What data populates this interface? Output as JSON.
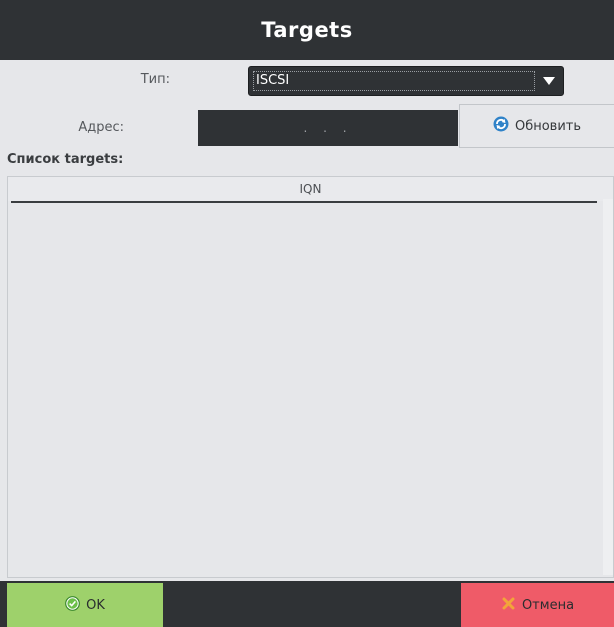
{
  "window": {
    "title": "Targets"
  },
  "form": {
    "type_label": "Тип:",
    "type_value": "ISCSI",
    "address_label": "Адрес:",
    "address_value": ". . .",
    "refresh_label": "Обновить"
  },
  "targets": {
    "title": "Список targets:",
    "columns": [
      "IQN"
    ],
    "rows": []
  },
  "footer": {
    "ok_label": "OK",
    "cancel_label": "Отмена"
  },
  "icons": {
    "dropdown": "chevron-down-icon",
    "refresh": "refresh-icon",
    "ok": "check-circle-icon",
    "cancel": "close-icon"
  },
  "colors": {
    "dark": "#2f3235",
    "ok": "#9ed16b",
    "cancel": "#ef5b68",
    "panel": "#e6e7ea"
  }
}
